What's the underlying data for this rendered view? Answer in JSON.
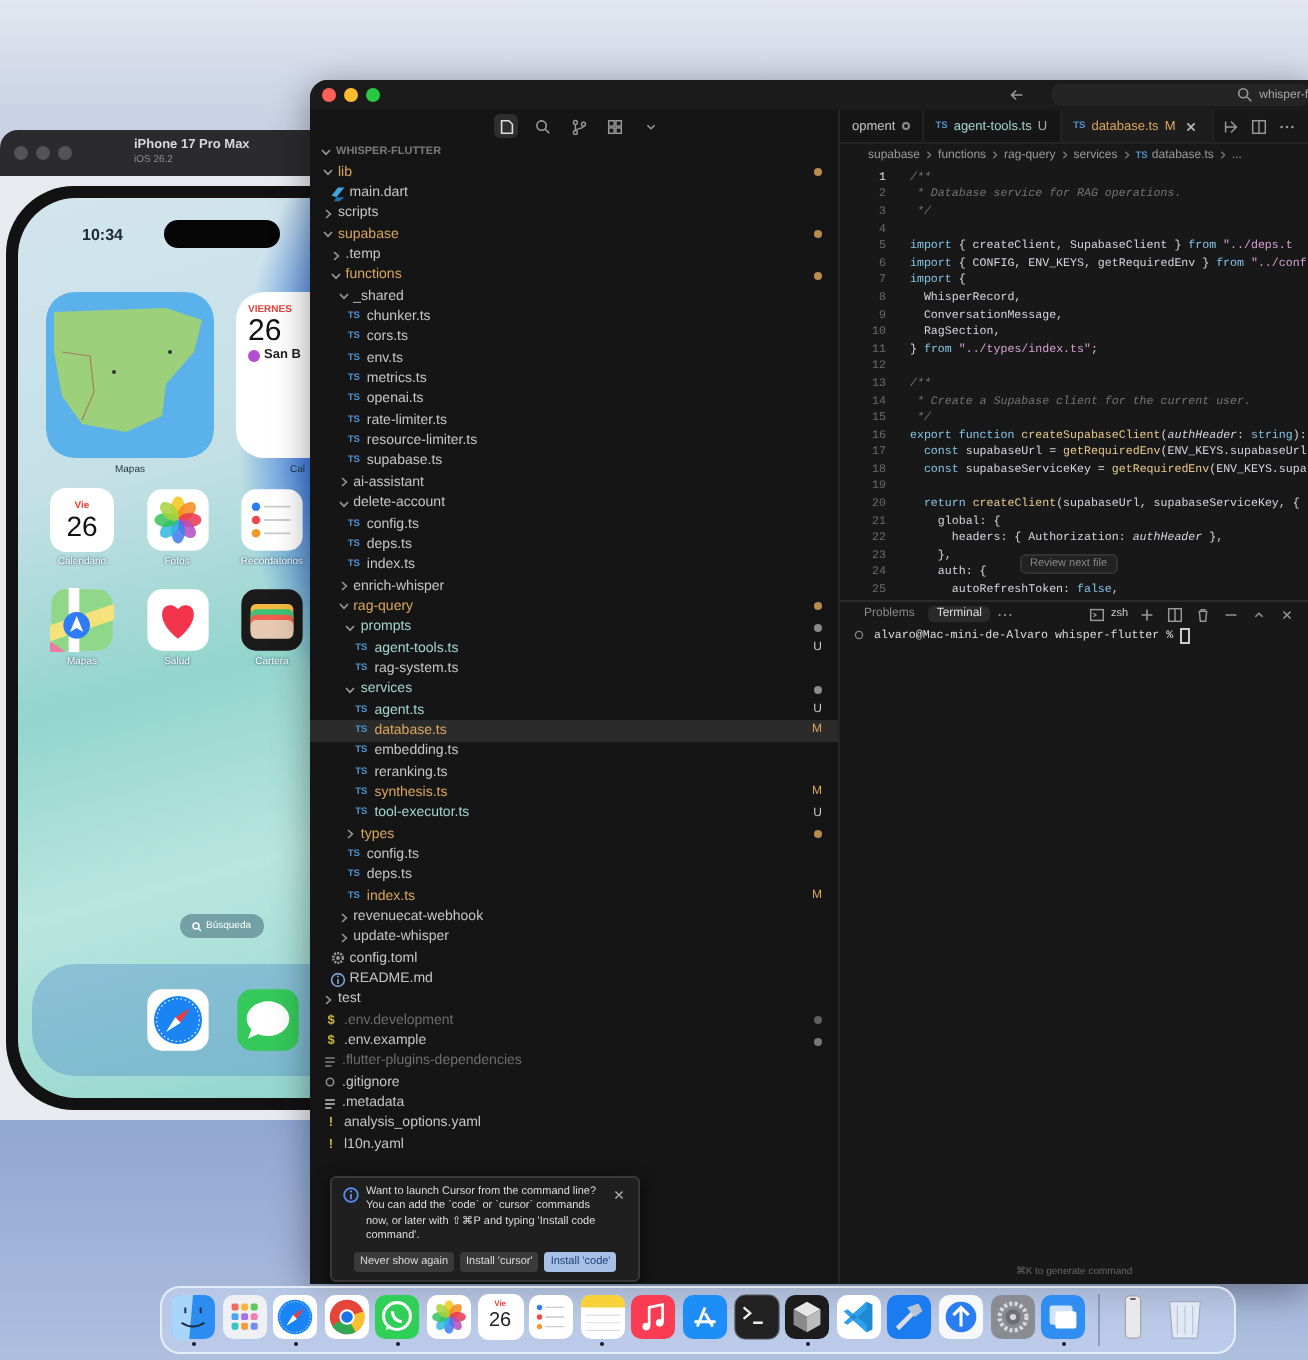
{
  "simulator": {
    "title": "iPhone 17 Pro Max",
    "subtitle": "iOS 26.2",
    "phone": {
      "time": "10:34",
      "widgets": [
        {
          "kind": "map",
          "label": "Mapas"
        },
        {
          "kind": "calendar",
          "label": "Cal",
          "weekday": "VIERNES",
          "date": "26",
          "event": "San B"
        }
      ],
      "apps": [
        {
          "kind": "calendar",
          "label": "Calendario",
          "day": "Vie",
          "date": "26"
        },
        {
          "kind": "photos",
          "label": "Fotos"
        },
        {
          "kind": "reminders",
          "label": "Recordatorios"
        },
        {
          "kind": "maps",
          "label": "Mapas"
        },
        {
          "kind": "health",
          "label": "Salud"
        },
        {
          "kind": "wallet",
          "label": "Cartera"
        }
      ],
      "search": "Búsqueda",
      "dock": [
        {
          "kind": "safari"
        },
        {
          "kind": "messages"
        }
      ]
    }
  },
  "editor": {
    "search": "whisper-f",
    "explorer": {
      "title": "WHISPER-FLUTTER",
      "expanded": true,
      "tree": [
        {
          "name": "lib",
          "kind": "folder",
          "expanded": true,
          "selected": false,
          "modified": true,
          "untracked": false,
          "dimmed": false,
          "dot": true,
          "children": [
            {
              "name": "main.dart",
              "kind": "dart",
              "selected": false,
              "modified": false,
              "untracked": false,
              "dimmed": false,
              "dot": false
            }
          ]
        },
        {
          "name": "scripts",
          "kind": "folder",
          "expanded": false,
          "selected": false,
          "modified": false,
          "untracked": false,
          "dimmed": false,
          "dot": false
        },
        {
          "name": "supabase",
          "kind": "folder",
          "expanded": true,
          "selected": false,
          "modified": true,
          "untracked": false,
          "dimmed": false,
          "dot": true,
          "children": [
            {
              "name": ".temp",
              "kind": "folder",
              "expanded": false,
              "selected": false,
              "modified": false,
              "untracked": false,
              "dimmed": false,
              "dot": false
            },
            {
              "name": "functions",
              "kind": "folder",
              "expanded": true,
              "selected": false,
              "modified": true,
              "untracked": false,
              "dimmed": false,
              "dot": true,
              "children": [
                {
                  "name": "_shared",
                  "kind": "folder",
                  "expanded": true,
                  "selected": false,
                  "modified": false,
                  "untracked": false,
                  "dimmed": false,
                  "dot": false,
                  "children": [
                    {
                      "name": "chunker.ts",
                      "kind": "ts",
                      "icon_text": "TS",
                      "selected": false,
                      "modified": false,
                      "untracked": false,
                      "dimmed": false,
                      "dot": false
                    },
                    {
                      "name": "cors.ts",
                      "kind": "ts",
                      "icon_text": "TS",
                      "selected": false,
                      "modified": false,
                      "untracked": false,
                      "dimmed": false,
                      "dot": false
                    },
                    {
                      "name": "env.ts",
                      "kind": "ts",
                      "icon_text": "TS",
                      "selected": false,
                      "modified": false,
                      "untracked": false,
                      "dimmed": false,
                      "dot": false
                    },
                    {
                      "name": "metrics.ts",
                      "kind": "ts",
                      "icon_text": "TS",
                      "selected": false,
                      "modified": false,
                      "untracked": false,
                      "dimmed": false,
                      "dot": false
                    },
                    {
                      "name": "openai.ts",
                      "kind": "ts",
                      "icon_text": "TS",
                      "selected": false,
                      "modified": false,
                      "untracked": false,
                      "dimmed": false,
                      "dot": false
                    },
                    {
                      "name": "rate-limiter.ts",
                      "kind": "ts",
                      "icon_text": "TS",
                      "selected": false,
                      "modified": false,
                      "untracked": false,
                      "dimmed": false,
                      "dot": false
                    },
                    {
                      "name": "resource-limiter.ts",
                      "kind": "ts",
                      "icon_text": "TS",
                      "selected": false,
                      "modified": false,
                      "untracked": false,
                      "dimmed": false,
                      "dot": false
                    },
                    {
                      "name": "supabase.ts",
                      "kind": "ts",
                      "icon_text": "TS",
                      "selected": false,
                      "modified": false,
                      "untracked": false,
                      "dimmed": false,
                      "dot": false
                    }
                  ]
                },
                {
                  "name": "ai-assistant",
                  "kind": "folder",
                  "expanded": false,
                  "selected": false,
                  "modified": false,
                  "untracked": false,
                  "dimmed": false,
                  "dot": false
                },
                {
                  "name": "delete-account",
                  "kind": "folder",
                  "expanded": true,
                  "selected": false,
                  "modified": false,
                  "untracked": false,
                  "dimmed": false,
                  "dot": false,
                  "children": [
                    {
                      "name": "config.ts",
                      "kind": "ts",
                      "icon_text": "TS",
                      "selected": false,
                      "modified": false,
                      "untracked": false,
                      "dimmed": false,
                      "dot": false
                    },
                    {
                      "name": "deps.ts",
                      "kind": "ts",
                      "icon_text": "TS",
                      "selected": false,
                      "modified": false,
                      "untracked": false,
                      "dimmed": false,
                      "dot": false
                    },
                    {
                      "name": "index.ts",
                      "kind": "ts",
                      "icon_text": "TS",
                      "selected": false,
                      "modified": false,
                      "untracked": false,
                      "dimmed": false,
                      "dot": false
                    }
                  ]
                },
                {
                  "name": "enrich-whisper",
                  "kind": "folder",
                  "expanded": false,
                  "selected": false,
                  "modified": false,
                  "untracked": false,
                  "dimmed": false,
                  "dot": false
                },
                {
                  "name": "rag-query",
                  "kind": "folder",
                  "expanded": true,
                  "selected": false,
                  "modified": true,
                  "untracked": false,
                  "dimmed": false,
                  "dot": true,
                  "children": [
                    {
                      "name": "prompts",
                      "kind": "folder",
                      "expanded": true,
                      "selected": false,
                      "modified": false,
                      "untracked": true,
                      "dimmed": false,
                      "dot": true,
                      "children": [
                        {
                          "name": "agent-tools.ts",
                          "kind": "ts",
                          "icon_text": "TS",
                          "selected": false,
                          "modified": false,
                          "untracked": true,
                          "dimmed": false,
                          "dot": false,
                          "badge": "U"
                        },
                        {
                          "name": "rag-system.ts",
                          "kind": "ts",
                          "icon_text": "TS",
                          "selected": false,
                          "modified": false,
                          "untracked": false,
                          "dimmed": false,
                          "dot": false
                        }
                      ]
                    },
                    {
                      "name": "services",
                      "kind": "folder",
                      "expanded": true,
                      "selected": false,
                      "modified": false,
                      "untracked": true,
                      "dimmed": false,
                      "dot": true,
                      "children": [
                        {
                          "name": "agent.ts",
                          "kind": "ts",
                          "icon_text": "TS",
                          "selected": false,
                          "modified": false,
                          "untracked": true,
                          "dimmed": false,
                          "dot": false,
                          "badge": "U"
                        },
                        {
                          "name": "database.ts",
                          "kind": "ts",
                          "icon_text": "TS",
                          "selected": true,
                          "modified": true,
                          "untracked": false,
                          "dimmed": false,
                          "dot": false,
                          "badge": "M"
                        },
                        {
                          "name": "embedding.ts",
                          "kind": "ts",
                          "icon_text": "TS",
                          "selected": false,
                          "modified": false,
                          "untracked": false,
                          "dimmed": false,
                          "dot": false
                        },
                        {
                          "name": "reranking.ts",
                          "kind": "ts",
                          "icon_text": "TS",
                          "selected": false,
                          "modified": false,
                          "untracked": false,
                          "dimmed": false,
                          "dot": false
                        },
                        {
                          "name": "synthesis.ts",
                          "kind": "ts",
                          "icon_text": "TS",
                          "selected": false,
                          "modified": true,
                          "untracked": false,
                          "dimmed": false,
                          "dot": false,
                          "badge": "M"
                        },
                        {
                          "name": "tool-executor.ts",
                          "kind": "ts",
                          "icon_text": "TS",
                          "selected": false,
                          "modified": false,
                          "untracked": true,
                          "dimmed": false,
                          "dot": false,
                          "badge": "U"
                        }
                      ]
                    },
                    {
                      "name": "types",
                      "kind": "folder",
                      "expanded": false,
                      "selected": false,
                      "modified": true,
                      "untracked": false,
                      "dimmed": false,
                      "dot": true
                    },
                    {
                      "name": "config.ts",
                      "kind": "ts",
                      "icon_text": "TS",
                      "selected": false,
                      "modified": false,
                      "untracked": false,
                      "dimmed": false,
                      "dot": false
                    },
                    {
                      "name": "deps.ts",
                      "kind": "ts",
                      "icon_text": "TS",
                      "selected": false,
                      "modified": false,
                      "untracked": false,
                      "dimmed": false,
                      "dot": false
                    },
                    {
                      "name": "index.ts",
                      "kind": "ts",
                      "icon_text": "TS",
                      "selected": false,
                      "modified": true,
                      "untracked": false,
                      "dimmed": false,
                      "dot": false,
                      "badge": "M"
                    }
                  ]
                },
                {
                  "name": "revenuecat-webhook",
                  "kind": "folder",
                  "expanded": false,
                  "selected": false,
                  "modified": false,
                  "untracked": false,
                  "dimmed": false,
                  "dot": false
                },
                {
                  "name": "update-whisper",
                  "kind": "folder",
                  "expanded": false,
                  "selected": false,
                  "modified": false,
                  "untracked": false,
                  "dimmed": false,
                  "dot": false
                }
              ]
            },
            {
              "name": "config.toml",
              "kind": "gear",
              "selected": false,
              "modified": false,
              "untracked": false,
              "dimmed": false,
              "dot": false
            },
            {
              "name": "README.md",
              "kind": "info",
              "selected": false,
              "modified": false,
              "untracked": false,
              "dimmed": false,
              "dot": false
            }
          ]
        },
        {
          "name": "test",
          "kind": "folder",
          "expanded": false,
          "selected": false,
          "modified": false,
          "untracked": false,
          "dimmed": false,
          "dot": false
        },
        {
          "name": ".env.development",
          "kind": "env",
          "icon_text": "$",
          "selected": false,
          "modified": false,
          "untracked": false,
          "dimmed": true,
          "dot": true
        },
        {
          "name": ".env.example",
          "kind": "env",
          "icon_text": "$",
          "selected": false,
          "modified": false,
          "untracked": false,
          "dimmed": false,
          "dot": true
        },
        {
          "name": ".flutter-plugins-dependencies",
          "kind": "list",
          "selected": false,
          "modified": false,
          "untracked": false,
          "dimmed": true,
          "dot": false
        },
        {
          "name": ".gitignore",
          "kind": "git",
          "selected": false,
          "modified": false,
          "untracked": false,
          "dimmed": false,
          "dot": false
        },
        {
          "name": ".metadata",
          "kind": "list",
          "selected": false,
          "modified": false,
          "untracked": false,
          "dimmed": false,
          "dot": false
        },
        {
          "name": "analysis_options.yaml",
          "kind": "yaml",
          "icon_text": "!",
          "selected": false,
          "modified": false,
          "untracked": false,
          "dimmed": false,
          "dot": false
        },
        {
          "name": "l10n.yaml",
          "kind": "yaml",
          "icon_text": "!",
          "selected": false,
          "modified": false,
          "untracked": false,
          "dimmed": false,
          "dot": false
        }
      ]
    },
    "tabs": [
      {
        "label": "opment",
        "dot": true,
        "modified": false,
        "untracked": false,
        "selected": false
      },
      {
        "icon_text": "TS",
        "label": "agent-tools.ts",
        "badge": "U",
        "modified": false,
        "untracked": true,
        "dot": false,
        "selected": false
      },
      {
        "icon_text": "TS",
        "label": "database.ts",
        "badge": "M",
        "modified": true,
        "untracked": false,
        "dot": false,
        "selected": true
      }
    ],
    "breadcrumb": [
      {
        "text": "supabase"
      },
      {
        "text": "functions"
      },
      {
        "text": "rag-query"
      },
      {
        "text": "services"
      },
      {
        "text": "database.ts",
        "icon_text": "TS"
      },
      {
        "text": "..."
      }
    ],
    "code": [
      {
        "number": "1",
        "segments": [
          {
            "text": "/**",
            "kind": "comment"
          }
        ]
      },
      {
        "number": "2",
        "segments": [
          {
            "text": " * Database service for RAG operations.",
            "kind": "comment"
          }
        ]
      },
      {
        "number": "3",
        "segments": [
          {
            "text": " */",
            "kind": "comment"
          }
        ]
      },
      {
        "number": "4"
      },
      {
        "number": "5",
        "segments": [
          {
            "text": "import",
            "kind": "keyword"
          },
          {
            "text": " { createClient, SupabaseClient } ",
            "kind": "plain"
          },
          {
            "text": "from",
            "kind": "keyword"
          },
          {
            "text": " \"../deps.t",
            "kind": "string"
          }
        ]
      },
      {
        "number": "6",
        "segments": [
          {
            "text": "import",
            "kind": "keyword"
          },
          {
            "text": " { CONFIG, ENV_KEYS, getRequiredEnv } ",
            "kind": "plain"
          },
          {
            "text": "from",
            "kind": "keyword"
          },
          {
            "text": " \"../conf",
            "kind": "string"
          }
        ]
      },
      {
        "number": "7",
        "segments": [
          {
            "text": "import",
            "kind": "keyword"
          },
          {
            "text": " {",
            "kind": "plain"
          }
        ]
      },
      {
        "number": "8",
        "segments": [
          {
            "text": "  WhisperRecord,",
            "kind": "plain"
          }
        ]
      },
      {
        "number": "9",
        "segments": [
          {
            "text": "  ConversationMessage,",
            "kind": "plain"
          }
        ]
      },
      {
        "number": "10",
        "segments": [
          {
            "text": "  RagSection,",
            "kind": "plain"
          }
        ]
      },
      {
        "number": "11",
        "segments": [
          {
            "text": "} ",
            "kind": "plain"
          },
          {
            "text": "from",
            "kind": "keyword"
          },
          {
            "text": " \"../types/index.ts\"",
            "kind": "string"
          },
          {
            "text": ";",
            "kind": "plain"
          }
        ]
      },
      {
        "number": "12"
      },
      {
        "number": "13",
        "segments": [
          {
            "text": "/**",
            "kind": "comment"
          }
        ]
      },
      {
        "number": "14",
        "segments": [
          {
            "text": " * Create a Supabase client for the current user.",
            "kind": "comment"
          }
        ]
      },
      {
        "number": "15",
        "segments": [
          {
            "text": " */",
            "kind": "comment"
          }
        ]
      },
      {
        "number": "16",
        "segments": [
          {
            "text": "export",
            "kind": "keyword"
          },
          {
            "text": " function",
            "kind": "keyword"
          },
          {
            "text": " createSupabaseClient",
            "kind": "function"
          },
          {
            "text": "(",
            "kind": "plain"
          },
          {
            "text": "authHeader",
            "kind": "param"
          },
          {
            "text": ": ",
            "kind": "plain"
          },
          {
            "text": "string",
            "kind": "keyword"
          },
          {
            "text": "):",
            "kind": "plain"
          }
        ]
      },
      {
        "number": "17",
        "segments": [
          {
            "text": "  const",
            "kind": "keyword"
          },
          {
            "text": " supabaseUrl = ",
            "kind": "plain"
          },
          {
            "text": "getRequiredEnv",
            "kind": "function"
          },
          {
            "text": "(ENV_KEYS.supabaseUrl",
            "kind": "plain"
          }
        ]
      },
      {
        "number": "18",
        "segments": [
          {
            "text": "  const",
            "kind": "keyword"
          },
          {
            "text": " supabaseServiceKey = ",
            "kind": "plain"
          },
          {
            "text": "getRequiredEnv",
            "kind": "function"
          },
          {
            "text": "(ENV_KEYS.supa",
            "kind": "plain"
          }
        ]
      },
      {
        "number": "19"
      },
      {
        "number": "20",
        "segments": [
          {
            "text": "  return",
            "kind": "keyword"
          },
          {
            "text": " createClient",
            "kind": "function"
          },
          {
            "text": "(supabaseUrl, supabaseServiceKey, {",
            "kind": "plain"
          }
        ]
      },
      {
        "number": "21",
        "segments": [
          {
            "text": "    global: {",
            "kind": "plain"
          }
        ]
      },
      {
        "number": "22",
        "segments": [
          {
            "text": "      headers: { Authorization: ",
            "kind": "plain"
          },
          {
            "text": "authHeader",
            "kind": "param"
          },
          {
            "text": " },",
            "kind": "plain"
          }
        ]
      },
      {
        "number": "23",
        "segments": [
          {
            "text": "    },",
            "kind": "plain"
          }
        ]
      },
      {
        "number": "24",
        "segments": [
          {
            "text": "    auth: {",
            "kind": "plain"
          }
        ]
      },
      {
        "number": "25",
        "segments": [
          {
            "text": "      autoRefreshToken: ",
            "kind": "plain"
          },
          {
            "text": "false",
            "kind": "keyword"
          },
          {
            "text": ",",
            "kind": "plain"
          }
        ]
      }
    ],
    "hover_hint": "Review next file",
    "panel": {
      "tabs": [
        {
          "label": "Problems",
          "selected": false
        },
        {
          "label": "Terminal",
          "selected": true
        }
      ],
      "shell": "zsh",
      "prompt": "alvaro@Mac-mini-de-Alvaro whisper-flutter %",
      "hint": "⌘K to generate command"
    },
    "notification": {
      "message": "Want to launch Cursor from the command line? You can add the `code` or `cursor` commands now, or later with ⇧⌘P and typing 'Install code command'.",
      "buttons": [
        {
          "label": "Never show again",
          "primary": false
        },
        {
          "label": "Install 'cursor'",
          "primary": false
        },
        {
          "label": "Install 'code'",
          "primary": true
        }
      ]
    }
  },
  "dock": [
    {
      "kind": "finder",
      "running": true
    },
    {
      "kind": "launchpad",
      "running": false
    },
    {
      "kind": "safari",
      "running": true
    },
    {
      "kind": "chrome",
      "running": false
    },
    {
      "kind": "whatsapp",
      "running": true
    },
    {
      "kind": "photos",
      "running": false
    },
    {
      "kind": "calendar",
      "running": false,
      "day": "Vie",
      "date": "26"
    },
    {
      "kind": "reminders",
      "running": false
    },
    {
      "kind": "notes",
      "running": true
    },
    {
      "kind": "music",
      "running": false
    },
    {
      "kind": "appstore",
      "running": false
    },
    {
      "kind": "terminal",
      "running": false
    },
    {
      "kind": "cube",
      "running": true
    },
    {
      "kind": "vscode",
      "running": false
    },
    {
      "kind": "xcode",
      "running": false
    },
    {
      "kind": "transporter",
      "running": false
    },
    {
      "kind": "settings",
      "running": false
    },
    {
      "kind": "simulator",
      "running": true
    },
    {
      "kind": "separator"
    },
    {
      "kind": "iphone",
      "running": false
    },
    {
      "kind": "trash",
      "running": false
    }
  ]
}
